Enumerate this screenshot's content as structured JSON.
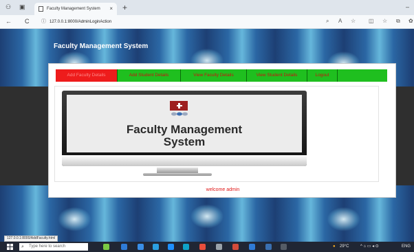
{
  "browser": {
    "tab_title": "Faculty Management System",
    "tab_close": "×",
    "new_tab": "+",
    "url": "127.0.0.1:8000/AdminLoginAction",
    "back": "←",
    "refresh": "C"
  },
  "page": {
    "site_title": "Faculty Management System",
    "menu": [
      {
        "label": "Add Faculty Details",
        "active": true
      },
      {
        "label": "Add Student Details",
        "active": false
      },
      {
        "label": "View Faculty Details",
        "active": false
      },
      {
        "label": "View Student Details",
        "active": false
      },
      {
        "label": "Logout",
        "active": false
      }
    ],
    "screen_title_line1": "Faculty Management",
    "screen_title_line2": "System",
    "welcome": "welcome admin",
    "status_url": "127.0.0.1:8000/AddFaculty.html"
  },
  "taskbar": {
    "search_placeholder": "Type here to search",
    "temperature": "29°C",
    "language": "ENG"
  },
  "colors": {
    "menu_bg": "#1fbf1f",
    "menu_active": "#ee1c1c",
    "menu_text": "#cc1010",
    "welcome_text": "#e01515"
  }
}
